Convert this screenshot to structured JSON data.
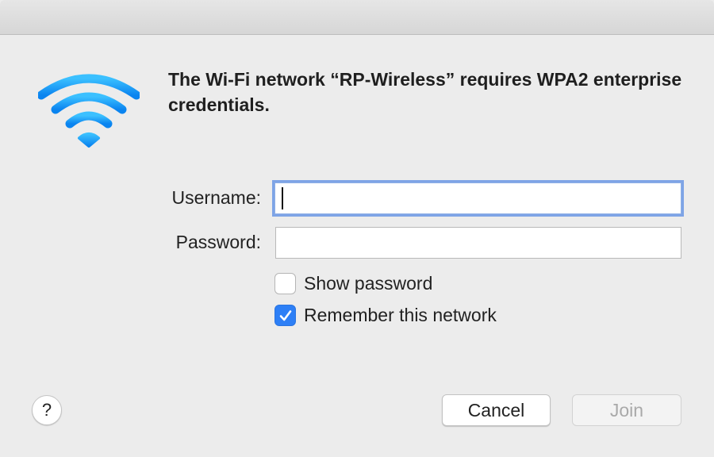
{
  "dialog": {
    "message": "The Wi-Fi network “RP-Wireless” requires WPA2 enterprise credentials."
  },
  "form": {
    "username_label": "Username:",
    "username_value": "",
    "password_label": "Password:",
    "password_value": ""
  },
  "options": {
    "show_password_label": "Show password",
    "show_password_checked": false,
    "remember_label": "Remember this network",
    "remember_checked": true
  },
  "buttons": {
    "help_label": "?",
    "cancel_label": "Cancel",
    "join_label": "Join",
    "join_enabled": false
  },
  "icons": {
    "wifi": "wifi-icon",
    "checkmark": "checkmark-icon"
  },
  "colors": {
    "wifi_blue": "#1aa5f5",
    "checkbox_blue": "#2d7ff6",
    "focus_ring": "#7ea4e6"
  }
}
